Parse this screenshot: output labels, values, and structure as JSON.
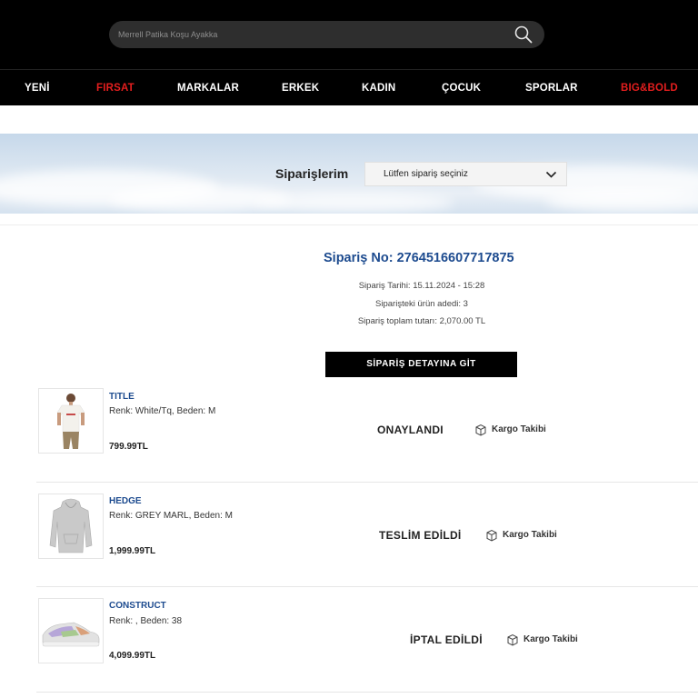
{
  "search": {
    "placeholder": "Merrell Patika Koşu Ayakka"
  },
  "nav": {
    "items": [
      {
        "label": "YENİ",
        "color": "#ffffff"
      },
      {
        "label": "FIRSAT",
        "color": "#e41e1e"
      },
      {
        "label": "MARKALAR",
        "color": "#ffffff"
      },
      {
        "label": "ERKEK",
        "color": "#ffffff"
      },
      {
        "label": "KADIN",
        "color": "#ffffff"
      },
      {
        "label": "ÇOCUK",
        "color": "#ffffff"
      },
      {
        "label": "SPORLAR",
        "color": "#ffffff"
      },
      {
        "label": "BIG&BOLD",
        "color": "#e41e1e"
      }
    ]
  },
  "orders": {
    "title": "Siparişlerim",
    "select_value": "Lütfen sipariş seçiniz"
  },
  "order": {
    "number": "Sipariş No: 2764516607717875",
    "date": "Sipariş Tarihi: 15.11.2024 - 15:28",
    "item_count": "Siparişteki ürün adedi: 3",
    "total": "Sipariş toplam tutarı: 2,070.00 TL",
    "detail_button": "SİPARİŞ DETAYINA GİT"
  },
  "items": [
    {
      "name": "TITLE",
      "variant": "Renk: White/Tq, Beden: M",
      "price": "799.99TL",
      "status": "ONAYLANDI",
      "cargo": "Kargo Takibi",
      "icon": "tshirt-product-image"
    },
    {
      "name": "HEDGE",
      "variant": "Renk: GREY MARL, Beden: M",
      "price": "1,999.99TL",
      "status": "TESLİM EDİLDİ",
      "cargo": "Kargo Takibi",
      "icon": "hoodie-product-image"
    },
    {
      "name": "CONSTRUCT",
      "variant": "Renk: , Beden: 38",
      "price": "4,099.99TL",
      "status": "İPTAL EDİLDİ",
      "cargo": "Kargo Takibi",
      "icon": "sneaker-product-image"
    }
  ],
  "colors": {
    "brand_blue": "#1d4b8f",
    "accent_red": "#e41e1e",
    "header_bg": "#000000"
  }
}
